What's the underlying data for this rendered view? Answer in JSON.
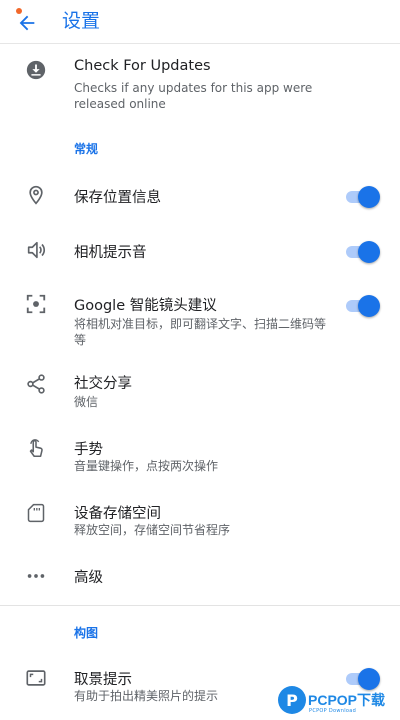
{
  "header": {
    "title": "设置"
  },
  "updates": {
    "title": "Check For Updates",
    "desc": "Checks if any updates for this app were released online"
  },
  "sections": {
    "general": "常规",
    "composition": "构图"
  },
  "items": [
    {
      "label": "保存位置信息",
      "icon": "location-pin-icon",
      "toggle": true
    },
    {
      "label": "相机提示音",
      "icon": "speaker-icon",
      "toggle": true
    },
    {
      "label": "Google 智能镜头建议",
      "desc": "将相机对准目标，即可翻译文字、扫描二维码等等",
      "icon": "lens-icon",
      "toggle": true
    },
    {
      "label": "社交分享",
      "desc": "微信",
      "icon": "share-icon"
    },
    {
      "label": "手势",
      "desc": "音量键操作，点按两次操作",
      "icon": "gesture-icon"
    },
    {
      "label": "设备存储空间",
      "desc": "释放空间，存储空间节省程序",
      "icon": "sd-card-icon"
    },
    {
      "label": "高级",
      "icon": "more-horiz-icon"
    },
    {
      "label": "取景提示",
      "desc": "有助于拍出精美照片的提示",
      "icon": "frame-icon",
      "toggle": true
    }
  ],
  "watermark": {
    "text": "PCPOP下载",
    "sub": "PCPOP Download"
  },
  "colors": {
    "accent": "#1a73e8",
    "track": "#aecbfa"
  }
}
